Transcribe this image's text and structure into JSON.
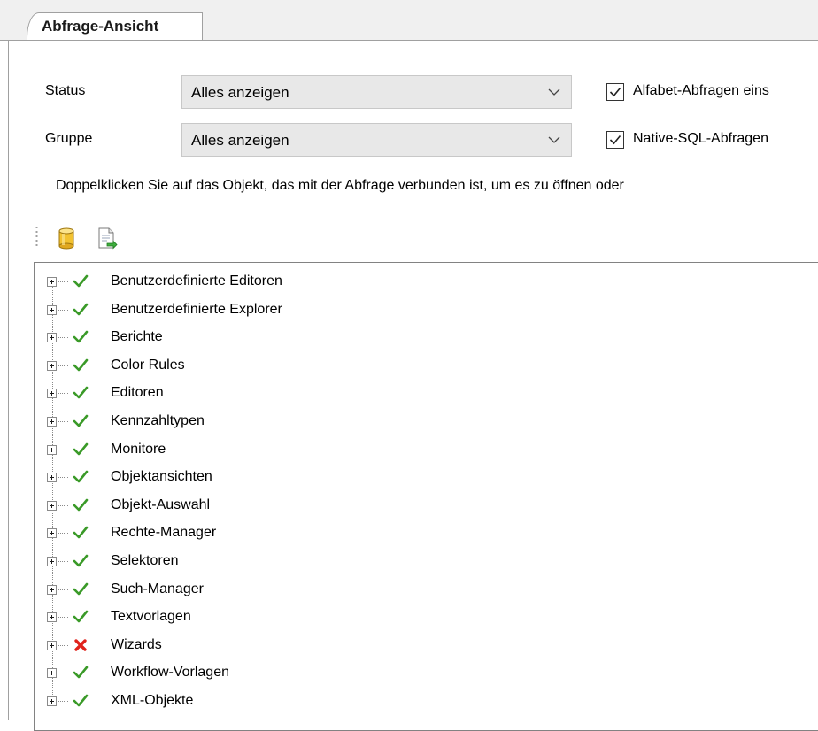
{
  "tab": {
    "label": "Abfrage-Ansicht"
  },
  "filters": {
    "status": {
      "label": "Status",
      "value": "Alles anzeigen"
    },
    "group": {
      "label": "Gruppe",
      "value": "Alles anzeigen"
    }
  },
  "options": {
    "alfabet": {
      "label": "Alfabet-Abfragen eins",
      "checked": true
    },
    "native_sql": {
      "label": "Native-SQL-Abfragen",
      "checked": true
    }
  },
  "hint": "Doppelklicken Sie auf das Objekt, das mit der Abfrage verbunden ist, um es zu öffnen oder",
  "toolbar": {
    "icons": [
      "database-icon",
      "export-document-icon"
    ]
  },
  "tree": {
    "items": [
      {
        "label": "Benutzerdefinierte Editoren",
        "status": "ok"
      },
      {
        "label": "Benutzerdefinierte Explorer",
        "status": "ok"
      },
      {
        "label": "Berichte",
        "status": "ok"
      },
      {
        "label": "Color Rules",
        "status": "ok"
      },
      {
        "label": "Editoren",
        "status": "ok"
      },
      {
        "label": "Kennzahltypen",
        "status": "ok"
      },
      {
        "label": "Monitore",
        "status": "ok"
      },
      {
        "label": "Objektansichten",
        "status": "ok"
      },
      {
        "label": "Objekt-Auswahl",
        "status": "ok"
      },
      {
        "label": "Rechte-Manager",
        "status": "ok"
      },
      {
        "label": "Selektoren",
        "status": "ok"
      },
      {
        "label": "Such-Manager",
        "status": "ok"
      },
      {
        "label": "Textvorlagen",
        "status": "ok"
      },
      {
        "label": "Wizards",
        "status": "error"
      },
      {
        "label": "Workflow-Vorlagen",
        "status": "ok"
      },
      {
        "label": "XML-Objekte",
        "status": "ok"
      }
    ]
  },
  "colors": {
    "ok": "#3a9a28",
    "error": "#e0221b"
  }
}
